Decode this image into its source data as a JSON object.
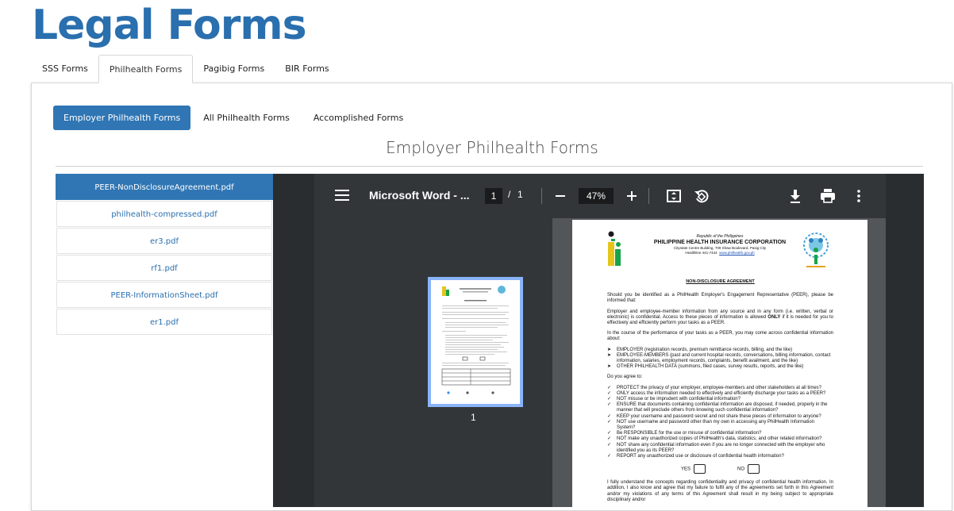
{
  "page": {
    "title": "Legal Forms"
  },
  "tabs": [
    {
      "label": "SSS Forms",
      "active": false
    },
    {
      "label": "Philhealth Forms",
      "active": true
    },
    {
      "label": "Pagibig Forms",
      "active": false
    },
    {
      "label": "BIR Forms",
      "active": false
    }
  ],
  "pills": [
    {
      "label": "Employer Philhealth Forms",
      "active": true
    },
    {
      "label": "All Philhealth Forms",
      "active": false
    },
    {
      "label": "Accomplished Forms",
      "active": false
    }
  ],
  "section_title": "Employer Philhealth Forms",
  "files": [
    {
      "label": "PEER-NonDisclosureAgreement.pdf",
      "active": true
    },
    {
      "label": "philhealth-compressed.pdf",
      "active": false
    },
    {
      "label": "er3.pdf",
      "active": false
    },
    {
      "label": "rf1.pdf",
      "active": false
    },
    {
      "label": "PEER-InformationSheet.pdf",
      "active": false
    },
    {
      "label": "er1.pdf",
      "active": false
    }
  ],
  "viewer": {
    "doc_name": "Microsoft Word - ...",
    "current_page": "1",
    "page_sep": "/",
    "total_pages": "1",
    "zoom": "47%",
    "thumb_label": "1",
    "icons": [
      "menu-icon",
      "zoom-out-icon",
      "zoom-in-icon",
      "fit-page-icon",
      "rotate-icon",
      "download-icon",
      "print-icon",
      "more-icon"
    ]
  },
  "document": {
    "republic": "Republic of the Philippines",
    "org": "PHILIPPINE HEALTH INSURANCE CORPORATION",
    "address": "Citystate Centre Building, 709 Shaw Boulevard, Pasig City",
    "hotline": "Healthline 441-7444",
    "website": "www.philhealth.gov.ph",
    "title": "NON-DISCLOSURE AGREEMENT",
    "intro": "Should you be identified as a PhilHealth Employer's Engagement Representative (PEER), please be informed that:",
    "para1_a": "Employer and employee-member information from any source and in any form (i.e. written, verbal or electronic) is confidential. Access to these pieces of information is allowed ",
    "para1_only": "ONLY",
    "para1_b": " if it is needed for you to effectively and efficiently perform your tasks as a PEER.",
    "para2": "In the course of the performance of your tasks as a PEER, you may come across confidential information about:",
    "about_items": [
      "EMPLOYER (registration records, premium remittance records, billing, and the like)",
      "EMPLOYEE-MEMBERS (past and current hospital records, conversations, billing information, contact information, salaries, employment records, complaints, benefit availment, and the like)",
      "OTHER PHILHEALTH DATA (summons, filed cases, survey results, reports, and the like)"
    ],
    "agree_intro": "Do you agree to:",
    "agree_items": [
      "PROTECT the privacy of your employer, employee-members and other stakeholders at all times?",
      "ONLY access the information needed to effectively and efficiently discharge your tasks as a PEER?",
      "NOT misuse or be imprudent with confidential information?",
      "ENSURE that documents containing confidential information are disposed, if needed, properly in the manner that will preclude others from knowing such confidential information?",
      "KEEP your username and password secret and not share these pieces of information to anyone?",
      "NOT use username and password other than my own in accessing any PhilHealth Information System?",
      "Be RESPONSIBLE for the use or misuse of confidential information?",
      "NOT make any unauthorized copies of PhilHealth's data, statistics, and other related information?",
      "NOT share any confidential information even if you are no longer connected with the employer who identified you as its PEER?",
      "REPORT any unauthorized use or disclosure of confidential health information?"
    ],
    "yes_label": "YES",
    "no_label": "NO",
    "closing": "I fully understand the concepts regarding confidentiality and privacy of confidential health information. In addition, I also know and agree that my failure to fulfil any of the agreements set forth in this Agreement and/or my violations of any terms of this Agreement shall result in my being subject to appropriate disciplinary and/or"
  },
  "colors": {
    "brand": "#2a6fae",
    "active_pill": "#3076b4",
    "viewer_bg": "#525659",
    "toolbar_bg": "#323639"
  }
}
